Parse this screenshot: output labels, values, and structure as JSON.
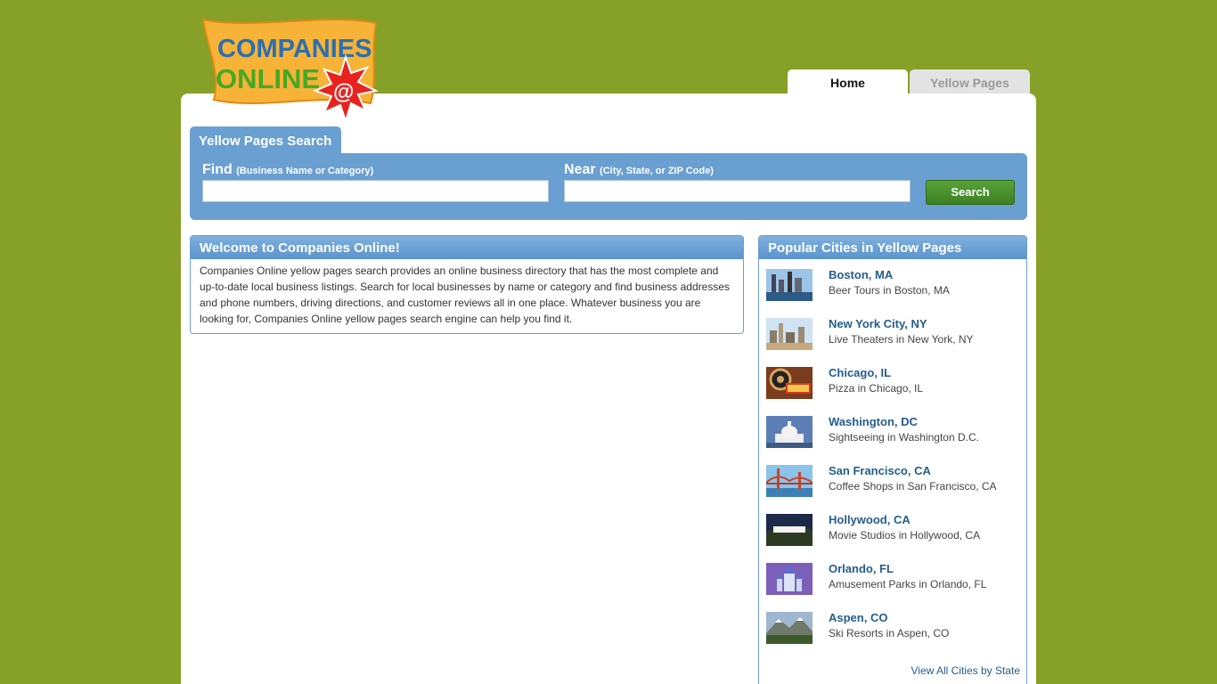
{
  "logo": {
    "line1": "COMPANIES",
    "line2": "ONLINE",
    "symbol": "@"
  },
  "nav": {
    "tabs": [
      {
        "label": "Home"
      },
      {
        "label": "Yellow Pages"
      }
    ]
  },
  "search": {
    "tab_label": "Yellow Pages Search",
    "find_label": "Find",
    "find_hint": "(Business Name or Category)",
    "find_value": "",
    "near_label": "Near",
    "near_hint": "(City, State, or ZIP Code)",
    "near_value": "",
    "button_label": "Search"
  },
  "welcome": {
    "title": "Welcome to Companies Online!",
    "body": "Companies Online yellow pages search provides an online business directory that has the most complete and up-to-date local business listings. Search for local businesses by name or category and find business addresses and phone numbers, driving directions, and customer reviews all in one place. Whatever business you are looking for, Companies Online yellow pages search engine can help you find it."
  },
  "cities": {
    "title": "Popular Cities in Yellow Pages",
    "items": [
      {
        "name": "Boston, MA",
        "desc": "Beer Tours in Boston, MA"
      },
      {
        "name": "New York City, NY",
        "desc": "Live Theaters in New York, NY"
      },
      {
        "name": "Chicago, IL",
        "desc": "Pizza in Chicago, IL"
      },
      {
        "name": "Washington, DC",
        "desc": "Sightseeing in Washington D.C."
      },
      {
        "name": "San Francisco, CA",
        "desc": "Coffee Shops in San Francisco, CA"
      },
      {
        "name": "Hollywood, CA",
        "desc": "Movie Studios in Hollywood, CA"
      },
      {
        "name": "Orlando, FL",
        "desc": "Amusement Parks in Orlando, FL"
      },
      {
        "name": "Aspen, CO",
        "desc": "Ski Resorts in Aspen, CO"
      }
    ],
    "view_all": "View All Cities by State"
  },
  "colors": {
    "background": "#87a027",
    "accent_blue": "#6a9fd1",
    "link": "#245c8e",
    "button_green": "#4a922d"
  }
}
